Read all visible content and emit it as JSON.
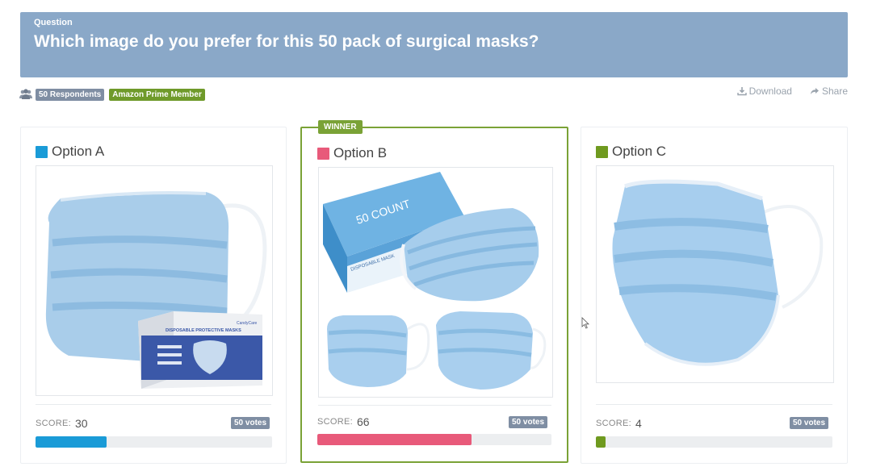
{
  "question": {
    "label": "Question",
    "text": "Which image do you prefer for this 50 pack of surgical masks?"
  },
  "meta": {
    "respondents": "50 Respondents",
    "audience": "Amazon Prime Member"
  },
  "actions": {
    "download": "Download",
    "share": "Share"
  },
  "options": [
    {
      "name": "Option A",
      "score_label": "SCORE:",
      "score": "30",
      "votes": "50 votes",
      "color": "#1a9bd7",
      "fill": 0.3,
      "winner": false
    },
    {
      "name": "Option B",
      "score_label": "SCORE:",
      "score": "66",
      "votes": "50 votes",
      "color": "#e85a7a",
      "fill": 0.66,
      "winner": true,
      "winner_label": "WINNER"
    },
    {
      "name": "Option C",
      "score_label": "SCORE:",
      "score": "4",
      "votes": "50 votes",
      "color": "#6f9a1f",
      "fill": 0.04,
      "winner": false
    }
  ],
  "product_box": {
    "option_a_brand": "CandyCare",
    "option_a_title": "DISPOSABLE PROTECTIVE MASKS",
    "option_b_count": "50 COUNT",
    "option_b_side": "DISPOSABLE MASK"
  }
}
